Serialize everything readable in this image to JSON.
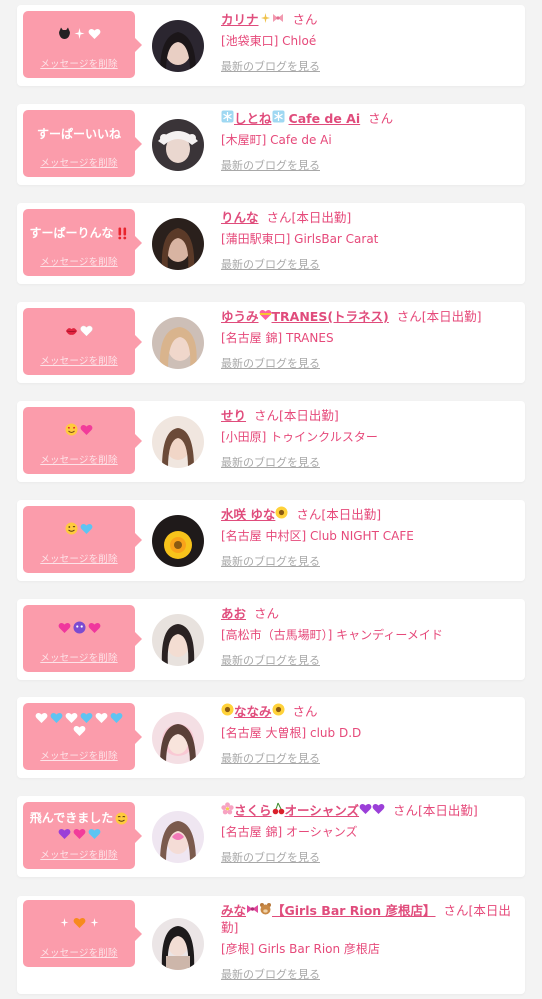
{
  "delete_label": "メッセージを削除",
  "blog_label": "最新のブログを見る",
  "honorific": "さん",
  "colors": {
    "bubble": "#fb9cab",
    "name": "#e04c7c",
    "blog_link": "#a8a8a8",
    "card": "#ffffff",
    "page_bg": "#f3f3f3"
  },
  "messages": [
    {
      "bubble_text": "",
      "bubble_icons": [
        "cat-icon",
        "sparkle-icon",
        "heart-icon"
      ],
      "name": "カリナ",
      "name_icons": [
        "sparkle-icon",
        "bow-icon"
      ],
      "status": "",
      "shop": "[池袋東口] Chloé"
    },
    {
      "bubble_text": "すーぱーいいね",
      "bubble_icons": [],
      "name": "しとね",
      "name_prefix": "Cafe de Ai",
      "name_icons": [
        "snowflake-icon"
      ],
      "status": "",
      "shop": "[木屋町] Cafe de Ai"
    },
    {
      "bubble_text": "すーぱーりんな",
      "bubble_icons": [
        "exclamation-icon"
      ],
      "name": "りんな",
      "name_icons": [],
      "status": "[本日出勤]",
      "shop": "[蒲田駅東口] GirlsBar Carat"
    },
    {
      "bubble_text": "",
      "bubble_icons": [
        "lips-icon",
        "heart-icon"
      ],
      "name": "ゆうみ",
      "name_suffix": "TRANES(トラネス)",
      "name_icons": [
        "heart-icon"
      ],
      "status": "[本日出勤]",
      "shop": "[名古屋 錦] TRANES"
    },
    {
      "bubble_text": "",
      "bubble_icons": [
        "smile-icon",
        "heart-icon"
      ],
      "name": "せり",
      "name_icons": [],
      "status": "[本日出勤]",
      "shop": "[小田原] トゥインクルスター"
    },
    {
      "bubble_text": "",
      "bubble_icons": [
        "smile-icon",
        "heart-icon"
      ],
      "name": "水咲 ゆな",
      "name_icons": [
        "sunflower-icon"
      ],
      "status": "[本日出勤]",
      "shop": "[名古屋 中村区] Club NIGHT CAFE"
    },
    {
      "bubble_text": "",
      "bubble_icons": [
        "heart-icon",
        "face-icon",
        "heart-icon"
      ],
      "name": "あお",
      "name_icons": [],
      "status": "",
      "shop": "[高松市（古馬場町）] キャンディーメイド"
    },
    {
      "bubble_text": "",
      "bubble_icons": [
        "heart-icon",
        "heart-icon",
        "heart-icon",
        "heart-icon",
        "heart-icon",
        "heart-icon",
        "heart-icon"
      ],
      "name": "ななみ",
      "name_icons": [
        "sunflower-icon",
        "sunflower-icon"
      ],
      "status": "",
      "shop": "[名古屋 大曽根] club D.D"
    },
    {
      "bubble_text": "飛んできました",
      "bubble_icons": [
        "smile-icon",
        "heart-icon",
        "heart-icon",
        "heart-icon"
      ],
      "name": "さくら",
      "name_suffix": "オーシャンズ",
      "name_icons": [
        "flower-icon",
        "cherry-icon",
        "heart-icon",
        "heart-icon"
      ],
      "status": "[本日出勤]",
      "shop": "[名古屋 錦] オーシャンズ"
    },
    {
      "bubble_text": "",
      "bubble_icons": [
        "sparkle-icon",
        "heart-icon",
        "sparkle-icon"
      ],
      "name": "みな",
      "name_suffix": "【Girls Bar Rion 彦根店】",
      "name_icons": [
        "bow-icon",
        "bear-icon"
      ],
      "status": "[本日出勤]",
      "shop": "[彦根] Girls Bar Rion 彦根店"
    }
  ]
}
